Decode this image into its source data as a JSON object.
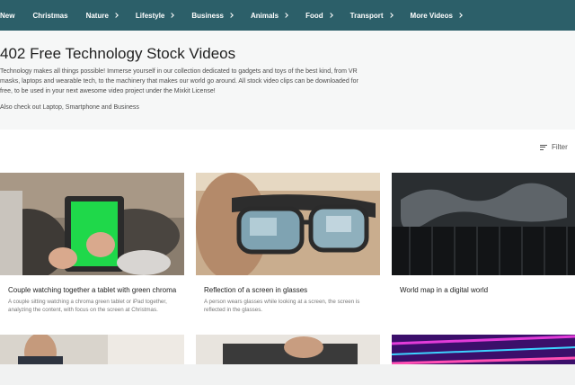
{
  "nav": {
    "items": [
      {
        "label": "New",
        "chevron": false
      },
      {
        "label": "Christmas",
        "chevron": false
      },
      {
        "label": "Nature",
        "chevron": true
      },
      {
        "label": "Lifestyle",
        "chevron": true
      },
      {
        "label": "Business",
        "chevron": true
      },
      {
        "label": "Animals",
        "chevron": true
      },
      {
        "label": "Food",
        "chevron": true
      },
      {
        "label": "Transport",
        "chevron": true
      },
      {
        "label": "More Videos",
        "chevron": true
      }
    ],
    "bg_color": "#2c5f69"
  },
  "hero": {
    "title": "402 Free Technology Stock Videos",
    "description": "Technology makes all things possible! Immerse yourself in our collection dedicated to gadgets and toys of the best kind, from VR masks, laptops and wearable tech, to the machinery that makes our world go around. All stock video clips can be downloaded for free, to be used in your next awesome video project under the Mixkit License!",
    "also": "Also check out Laptop, Smartphone and Business"
  },
  "filter": {
    "label": "Filter",
    "icon": "filter-icon"
  },
  "cards": [
    {
      "title": "Couple watching together a tablet with green chroma",
      "description": "A couple sitting watching a chroma green tablet or iPad together, analyzing the content, with focus on the screen at Christmas."
    },
    {
      "title": "Reflection of a screen in glasses",
      "description": "A person wears glasses while looking at a screen, the screen is reflected in the glasses."
    },
    {
      "title": "World map in a digital world",
      "description": ""
    }
  ]
}
